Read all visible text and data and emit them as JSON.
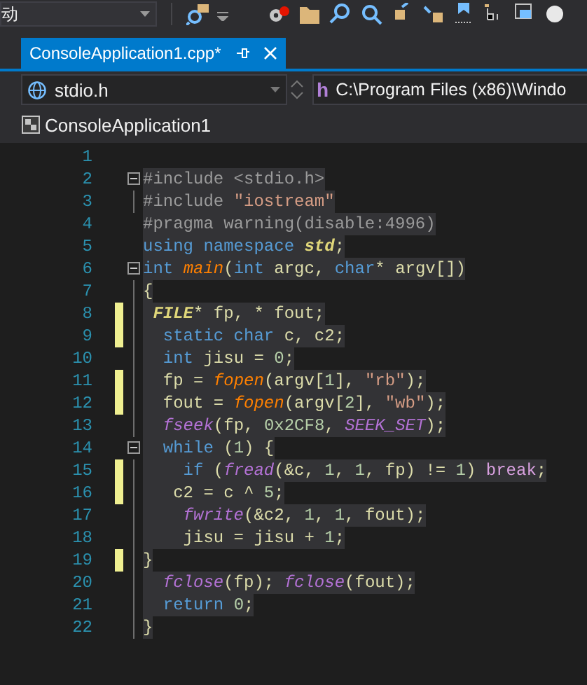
{
  "toolbar": {
    "config_label": "动"
  },
  "tab": {
    "label": "ConsoleApplication1.cpp*",
    "selected": true
  },
  "nav": {
    "scope": "stdio.h",
    "member_icon": "h",
    "member": "C:\\Program Files (x86)\\Windo"
  },
  "project": "ConsoleApplication1",
  "lines": [
    {
      "number": "1",
      "modified": false,
      "fold": false,
      "guide": false
    },
    {
      "number": "2",
      "modified": false,
      "fold": true,
      "guide": false,
      "tokens": [
        {
          "kind": "pre",
          "text": "#include <stdio.h>"
        }
      ]
    },
    {
      "number": "3",
      "modified": false,
      "fold": false,
      "guide": true,
      "tokens": [
        {
          "kind": "pre",
          "text": "#include "
        },
        {
          "kind": "string",
          "text": "\"iostream\""
        }
      ]
    },
    {
      "number": "4",
      "modified": false,
      "fold": false,
      "guide": false,
      "tokens": [
        {
          "kind": "pre",
          "text": "#pragma warning(disable:4996)"
        }
      ]
    },
    {
      "number": "5",
      "modified": false,
      "fold": false,
      "guide": false,
      "tokens": [
        {
          "kind": "keyword",
          "text": "using namespace "
        },
        {
          "kind": "type",
          "text": "std"
        },
        {
          "kind": "plain",
          "text": ";"
        }
      ]
    },
    {
      "number": "6",
      "modified": false,
      "fold": true,
      "guide": false,
      "tokens": [
        {
          "kind": "keyword",
          "text": "int "
        },
        {
          "kind": "func",
          "text": "main"
        },
        {
          "kind": "plain",
          "text": "("
        },
        {
          "kind": "keyword",
          "text": "int"
        },
        {
          "kind": "plain",
          "text": " argc, "
        },
        {
          "kind": "keyword",
          "text": "char"
        },
        {
          "kind": "plain",
          "text": "* argv[])"
        }
      ]
    },
    {
      "number": "7",
      "modified": false,
      "fold": false,
      "guide": true,
      "tokens": [
        {
          "kind": "plain",
          "text": "{"
        }
      ]
    },
    {
      "number": "8",
      "modified": true,
      "fold": false,
      "guide": true,
      "tokens": [
        {
          "kind": "type",
          "text": " FILE"
        },
        {
          "kind": "plain",
          "text": "* fp, * fout;"
        }
      ]
    },
    {
      "number": "9",
      "modified": true,
      "fold": false,
      "guide": true,
      "tokens": [
        {
          "kind": "keyword",
          "text": "  static char"
        },
        {
          "kind": "plain",
          "text": " c, c2;"
        }
      ]
    },
    {
      "number": "10",
      "modified": false,
      "fold": false,
      "guide": true,
      "tokens": [
        {
          "kind": "keyword",
          "text": "  int"
        },
        {
          "kind": "plain",
          "text": " jisu = "
        },
        {
          "kind": "number",
          "text": "0"
        },
        {
          "kind": "plain",
          "text": ";"
        }
      ]
    },
    {
      "number": "11",
      "modified": true,
      "fold": false,
      "guide": true,
      "tokens": [
        {
          "kind": "plain",
          "text": "  fp = "
        },
        {
          "kind": "func",
          "text": "fopen"
        },
        {
          "kind": "plain",
          "text": "(argv["
        },
        {
          "kind": "number",
          "text": "1"
        },
        {
          "kind": "plain",
          "text": "], "
        },
        {
          "kind": "string",
          "text": "\"rb\""
        },
        {
          "kind": "plain",
          "text": ");"
        }
      ]
    },
    {
      "number": "12",
      "modified": true,
      "fold": false,
      "guide": true,
      "tokens": [
        {
          "kind": "plain",
          "text": "  fout = "
        },
        {
          "kind": "func",
          "text": "fopen"
        },
        {
          "kind": "plain",
          "text": "(argv["
        },
        {
          "kind": "number",
          "text": "2"
        },
        {
          "kind": "plain",
          "text": "], "
        },
        {
          "kind": "string",
          "text": "\"wb\""
        },
        {
          "kind": "plain",
          "text": ");"
        }
      ]
    },
    {
      "number": "13",
      "modified": false,
      "fold": false,
      "guide": true,
      "tokens": [
        {
          "kind": "call",
          "text": "  fseek"
        },
        {
          "kind": "plain",
          "text": "(fp, "
        },
        {
          "kind": "number",
          "text": "0x2CF8"
        },
        {
          "kind": "plain",
          "text": ", "
        },
        {
          "kind": "call",
          "text": "SEEK_SET"
        },
        {
          "kind": "plain",
          "text": ");"
        }
      ]
    },
    {
      "number": "14",
      "modified": false,
      "fold": true,
      "guide": false,
      "tokens": [
        {
          "kind": "keyword",
          "text": "  while"
        },
        {
          "kind": "plain",
          "text": " ("
        },
        {
          "kind": "number",
          "text": "1"
        },
        {
          "kind": "plain",
          "text": ") {"
        }
      ]
    },
    {
      "number": "15",
      "modified": true,
      "fold": false,
      "guide": true,
      "tokens": [
        {
          "kind": "keyword",
          "text": "    if"
        },
        {
          "kind": "plain",
          "text": " ("
        },
        {
          "kind": "call",
          "text": "fread"
        },
        {
          "kind": "plain",
          "text": "(&c, "
        },
        {
          "kind": "number",
          "text": "1"
        },
        {
          "kind": "plain",
          "text": ", "
        },
        {
          "kind": "number",
          "text": "1"
        },
        {
          "kind": "plain",
          "text": ", fp) != "
        },
        {
          "kind": "number",
          "text": "1"
        },
        {
          "kind": "plain",
          "text": ") "
        },
        {
          "kind": "control",
          "text": "break"
        },
        {
          "kind": "plain",
          "text": ";"
        }
      ]
    },
    {
      "number": "16",
      "modified": true,
      "fold": false,
      "guide": true,
      "tokens": [
        {
          "kind": "plain",
          "text": "   c2 = c ^ "
        },
        {
          "kind": "number",
          "text": "5"
        },
        {
          "kind": "plain",
          "text": ";"
        }
      ]
    },
    {
      "number": "17",
      "modified": false,
      "fold": false,
      "guide": true,
      "tokens": [
        {
          "kind": "call",
          "text": "    fwrite"
        },
        {
          "kind": "plain",
          "text": "(&c2, "
        },
        {
          "kind": "number",
          "text": "1"
        },
        {
          "kind": "plain",
          "text": ", "
        },
        {
          "kind": "number",
          "text": "1"
        },
        {
          "kind": "plain",
          "text": ", fout);"
        }
      ]
    },
    {
      "number": "18",
      "modified": false,
      "fold": false,
      "guide": true,
      "tokens": [
        {
          "kind": "plain",
          "text": "    jisu = jisu + "
        },
        {
          "kind": "number",
          "text": "1"
        },
        {
          "kind": "plain",
          "text": ";"
        }
      ]
    },
    {
      "number": "19",
      "modified": true,
      "fold": false,
      "guide": true,
      "tokens": [
        {
          "kind": "plain",
          "text": "}"
        }
      ]
    },
    {
      "number": "20",
      "modified": false,
      "fold": false,
      "guide": true,
      "tokens": [
        {
          "kind": "call",
          "text": "  fclose"
        },
        {
          "kind": "plain",
          "text": "(fp); "
        },
        {
          "kind": "call",
          "text": "fclose"
        },
        {
          "kind": "plain",
          "text": "(fout);"
        }
      ]
    },
    {
      "number": "21",
      "modified": false,
      "fold": false,
      "guide": true,
      "tokens": [
        {
          "kind": "keyword",
          "text": "  return "
        },
        {
          "kind": "number",
          "text": "0"
        },
        {
          "kind": "plain",
          "text": ";"
        }
      ]
    },
    {
      "number": "22",
      "modified": false,
      "fold": false,
      "guide": true,
      "tokens": [
        {
          "kind": "plain",
          "text": "}"
        }
      ]
    }
  ]
}
